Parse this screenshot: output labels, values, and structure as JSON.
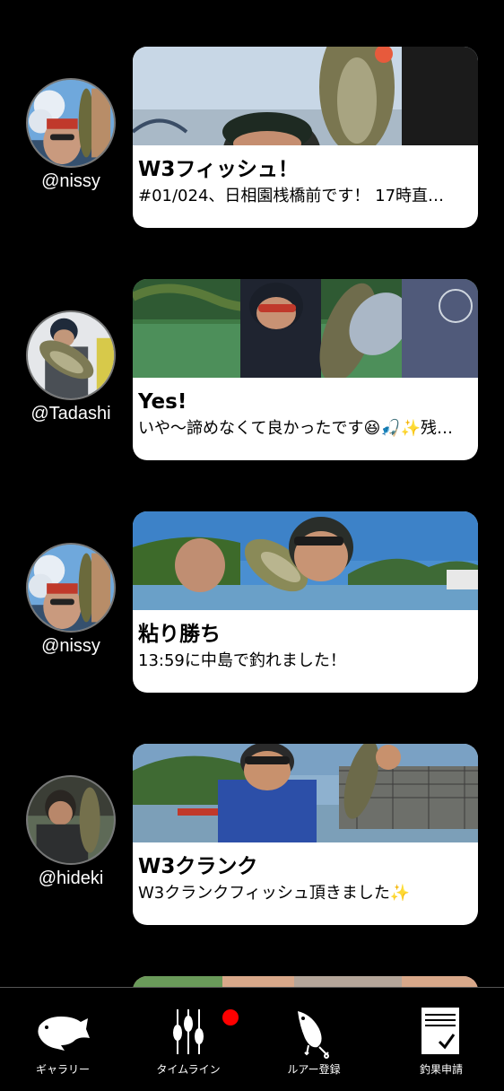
{
  "feed": {
    "posts": [
      {
        "username": "@nissy",
        "title": "W3フィッシュ！",
        "text": "#01/024、日相園桟橋前です！ 17時直…"
      },
      {
        "username": "@Tadashi",
        "title": "Yes!",
        "text": "いや〜諦めなくて良かったです😆🎣✨残…"
      },
      {
        "username": "@nissy",
        "title": "粘り勝ち",
        "text": "13:59に中島で釣れました！"
      },
      {
        "username": "@hideki",
        "title": "W3クランク",
        "text": "W3クランクフィッシュ頂きました✨"
      }
    ]
  },
  "tabbar": {
    "tabs": [
      {
        "label": "ギャラリー",
        "icon": "bass-fish-icon"
      },
      {
        "label": "タイムライン",
        "icon": "timeline-floats-icon",
        "badge": true
      },
      {
        "label": "ルアー登録",
        "icon": "lure-icon"
      },
      {
        "label": "釣果申請",
        "icon": "document-check-icon"
      }
    ],
    "badge_color": "#ff0000"
  }
}
